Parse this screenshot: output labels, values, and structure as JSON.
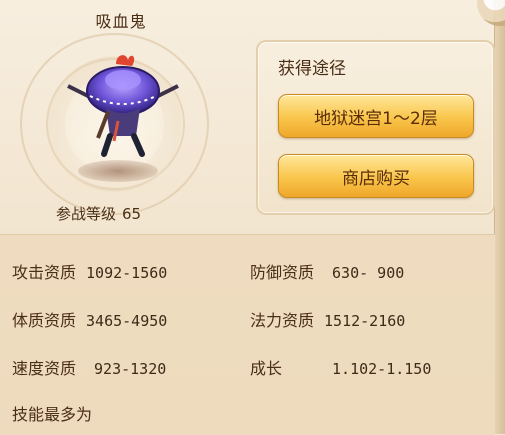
{
  "pet": {
    "name": "吸血鬼",
    "level_label": "参战等级",
    "level_value": "65"
  },
  "source_panel": {
    "title": "获得途径",
    "buttons": [
      {
        "label": "地狱迷宫1～2层"
      },
      {
        "label": "商店购买"
      }
    ]
  },
  "stats": {
    "attack": {
      "label": "攻击资质",
      "value": "1092-1560"
    },
    "defense": {
      "label": "防御资质",
      "value": "630- 900"
    },
    "stamina": {
      "label": "体质资质",
      "value": "3465-4950"
    },
    "magic": {
      "label": "法力资质",
      "value": "1512-2160"
    },
    "speed": {
      "label": "速度资质",
      "value": "923-1320"
    },
    "growth": {
      "label": "成长",
      "value": "1.102-1.150"
    }
  },
  "skills": {
    "title": "技能最多为"
  },
  "colors": {
    "button_gold": "#f9c54b",
    "panel_bg": "#f2e4cb",
    "text_brown": "#4b2e16"
  }
}
